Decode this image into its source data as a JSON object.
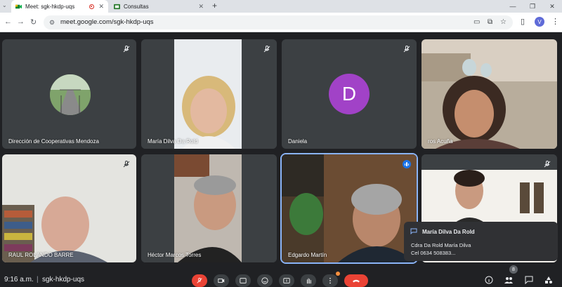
{
  "browser": {
    "tabs": [
      {
        "title": "Meet: sgk-hkdp-uqs",
        "active": true
      },
      {
        "title": "Consultas",
        "active": false
      }
    ],
    "new_tab_label": "+",
    "url": "meet.google.com/sgk-hkdp-uqs",
    "profile_initial": "V"
  },
  "participants": [
    {
      "name": "Dirección de Cooperativas Mendoza",
      "muted": true
    },
    {
      "name": "María Dilva Da Rold",
      "muted": true
    },
    {
      "name": "Daniela",
      "muted": true,
      "initial": "D"
    },
    {
      "name": "ros Acuña",
      "muted": true
    },
    {
      "name": "RAUL ROLANDO BARRE",
      "muted": true
    },
    {
      "name": "Héctor Marcos Torres",
      "muted": true
    },
    {
      "name": "Edgardo Martín",
      "muted": false,
      "speaking": true
    },
    {
      "name": "",
      "muted": true
    }
  ],
  "chat_popup": {
    "sender": "María Dilva Da Rold",
    "line1": "Cdra Da Rold María Dilva",
    "line2": "Cel 0634 508383..."
  },
  "bottom": {
    "time": "9:16 a.m.",
    "separator": "|",
    "meeting_code": "sgk-hkdp-uqs",
    "people_count": "8"
  },
  "colors": {
    "background": "#202124",
    "tile": "#3c4043",
    "danger": "#ea4335",
    "accent": "#8ab4f8",
    "avatar_purple": "#a142c7"
  }
}
